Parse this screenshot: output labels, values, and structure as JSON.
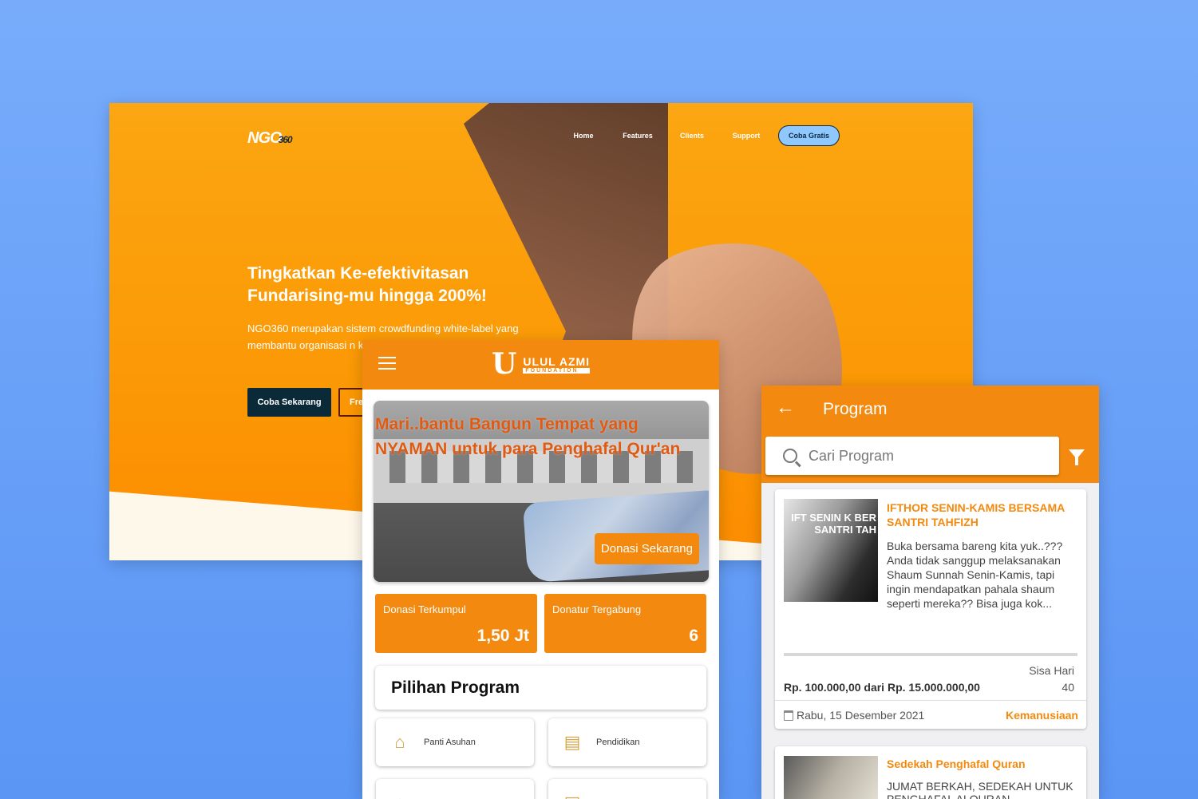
{
  "landing": {
    "logo": "NGO",
    "logo_suffix": "360",
    "nav": [
      "Home",
      "Features",
      "Clients",
      "Support"
    ],
    "cta": "Coba Gratis",
    "hero_title": "Tingkatkan Ke-efektivitasan Fundarising-mu hingga 200%!",
    "hero_desc": "NGO360 merupakan sistem crowdfunding white-label yang membantu organisasi n kepercayaan di mata do",
    "btn_primary": "Coba Sekarang",
    "btn_secondary": "Fre"
  },
  "app_home": {
    "brand_name": "ULUL AZMI",
    "brand_sub": "FOUNDATION",
    "banner_text": "Mari..bantu Bangun Tempat yang NYAMAN untuk para Penghafal Qur'an",
    "banner_button": "Donasi Sekarang",
    "stats": [
      {
        "label": "Donasi Terkumpul",
        "value": "1,50 Jt"
      },
      {
        "label": "Donatur Tergabung",
        "value": "6"
      }
    ],
    "section_title": "Pilihan Program",
    "categories": [
      {
        "label": "Panti Asuhan",
        "icon": "orphanage-icon"
      },
      {
        "label": "Pendidikan",
        "icon": "books-icon"
      },
      {
        "label": "",
        "icon": "category-icon"
      },
      {
        "label": "",
        "icon": "category-icon"
      }
    ]
  },
  "app_program": {
    "title": "Program",
    "search_placeholder": "Cari Program",
    "cards": [
      {
        "thumb_text": "IFT SENIN K BER SANTRI TAH",
        "title": "IFTHOR SENIN-KAMIS BERSAMA SANTRI TAHFIZH",
        "desc": "Buka bersama bareng kita yuk..??? Anda tidak sanggup melaksanakan Shaum Sunnah Senin-Kamis, tapi ingin mendapatkan pahala shaum seperti mereka?? Bisa juga kok...",
        "sisa_label": "Sisa Hari",
        "sisa_value": "40",
        "amount": "Rp. 100.000,00 dari Rp. 15.000.000,00",
        "date": "Rabu, 15 Desember 2021",
        "tag": "Kemanusiaan"
      },
      {
        "title": "Sedekah Penghafal Quran",
        "desc": "JUMAT BERKAH, SEDEKAH UNTUK PENGHAFAL ALQURAN"
      }
    ]
  },
  "colors": {
    "background": "#6aa3f8",
    "accent": "#f38a0f",
    "dark_button": "#0b2a38"
  }
}
